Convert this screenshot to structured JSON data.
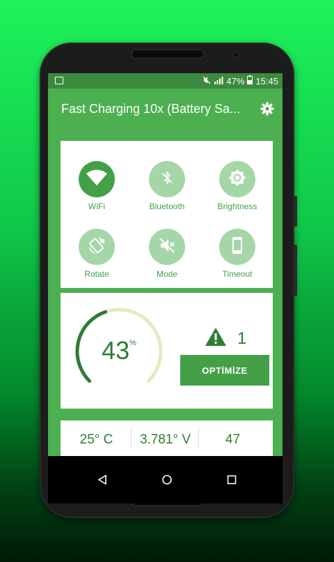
{
  "status": {
    "battery": "47%",
    "time": "15:45"
  },
  "toolbar": {
    "title": "Fast Charging 10x (Battery Sa..."
  },
  "quick_settings": [
    {
      "label": "WiFi",
      "icon": "wifi-icon",
      "active": true
    },
    {
      "label": "Bluetooth",
      "icon": "bluetooth-off-icon",
      "active": false
    },
    {
      "label": "Brightness",
      "icon": "brightness-icon",
      "active": false
    },
    {
      "label": "Rotate",
      "icon": "screen-rotate-icon",
      "active": false
    },
    {
      "label": "Mode",
      "icon": "sound-mute-icon",
      "active": false
    },
    {
      "label": "Timeout",
      "icon": "phone-timeout-icon",
      "active": false
    }
  ],
  "battery": {
    "percent": "43",
    "percent_sign": "%",
    "level": 0.43,
    "warnings": "1",
    "optimize_label": "OPTİMİZE"
  },
  "stats": {
    "temperature": "25° C",
    "voltage": "3.781° V",
    "value": "47"
  },
  "colors": {
    "primary": "#4caf50",
    "dark": "#2e7d32",
    "light": "#a5d6a7",
    "gauge_track": "#e6ebbf"
  }
}
